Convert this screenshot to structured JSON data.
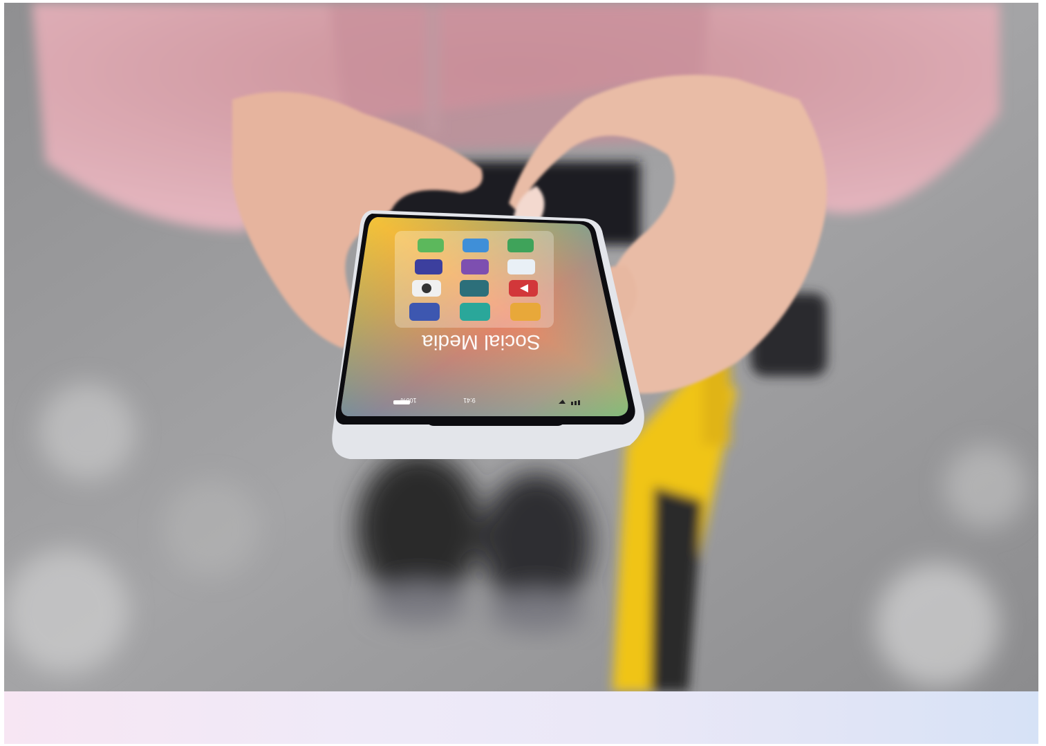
{
  "scene": {
    "description_free": true
  },
  "phone_screen": {
    "heading": "Social Media",
    "status_time": "9:41",
    "status_battery": "100%"
  },
  "app_icons": [
    {
      "icon": "folder-icon",
      "color": "#5cb85c"
    },
    {
      "icon": "car-icon",
      "color": "#3f8fd8"
    },
    {
      "icon": "phone-icon",
      "color": "#3fa35a"
    },
    {
      "icon": "keyboard-icon",
      "color": "#3c3f9e"
    },
    {
      "icon": "robot-icon",
      "color": "#7d4fb0"
    },
    {
      "icon": "chart-icon",
      "color": "#e9f0f6"
    },
    {
      "icon": "aperture-icon",
      "color": "#f0f0f0"
    },
    {
      "icon": "magnet-icon",
      "color": "#2c6f7a"
    },
    {
      "icon": "play-icon",
      "color": "#d2373a"
    },
    {
      "icon": "note-icon",
      "color": "#3d57b0"
    },
    {
      "icon": "lock-icon",
      "color": "#2aa79a"
    },
    {
      "icon": "person-icon",
      "color": "#e8a83a"
    }
  ],
  "colors": {
    "jacket": "#d9a3ae",
    "ground": "#9a9a9c",
    "bike_frame": "#f0c419",
    "skin": "#e8b8a2"
  }
}
